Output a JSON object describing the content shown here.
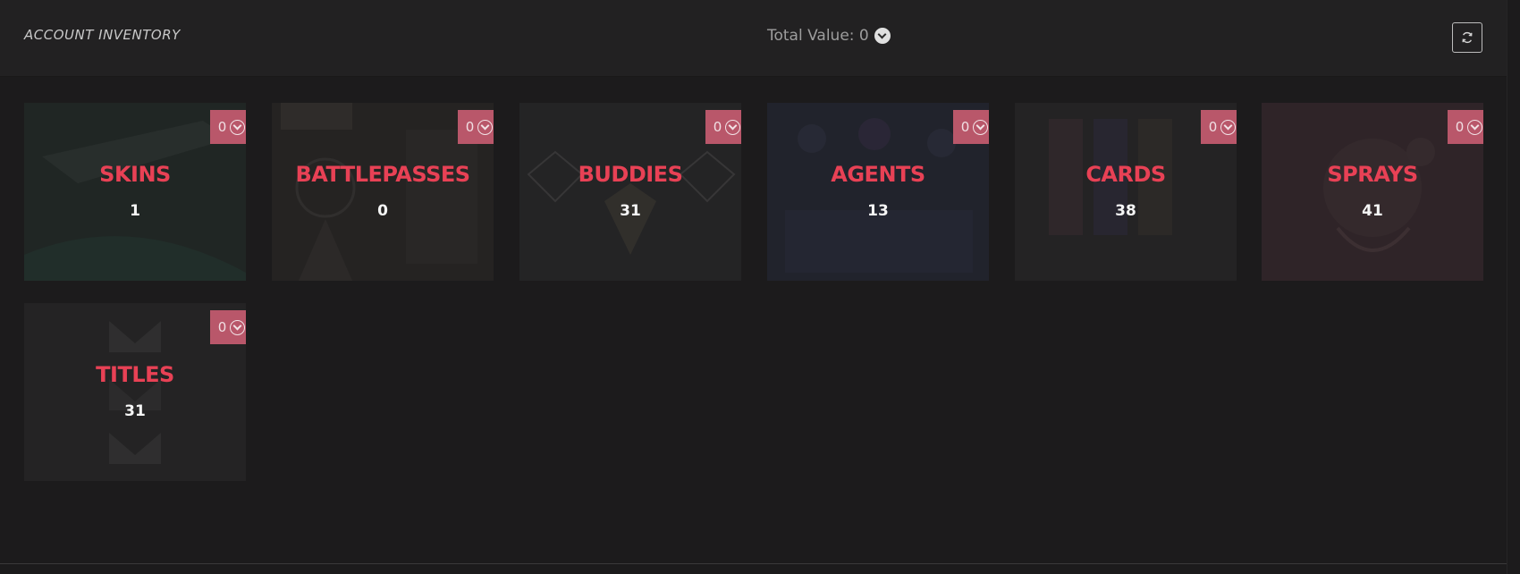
{
  "header": {
    "title": "ACCOUNT INVENTORY",
    "total_label": "Total Value: 0",
    "currency_icon": "valorant-points-icon",
    "refresh_icon": "refresh-icon"
  },
  "categories": [
    {
      "name": "SKINS",
      "count": "1",
      "value": "0"
    },
    {
      "name": "BATTLEPASSES",
      "count": "0",
      "value": "0"
    },
    {
      "name": "BUDDIES",
      "count": "31",
      "value": "0"
    },
    {
      "name": "AGENTS",
      "count": "13",
      "value": "0"
    },
    {
      "name": "CARDS",
      "count": "38",
      "value": "0"
    },
    {
      "name": "SPRAYS",
      "count": "41",
      "value": "0"
    },
    {
      "name": "TITLES",
      "count": "31",
      "value": "0"
    }
  ],
  "colors": {
    "accent": "#e84155",
    "badge": "#b9576a",
    "background": "#1c1b1c"
  }
}
